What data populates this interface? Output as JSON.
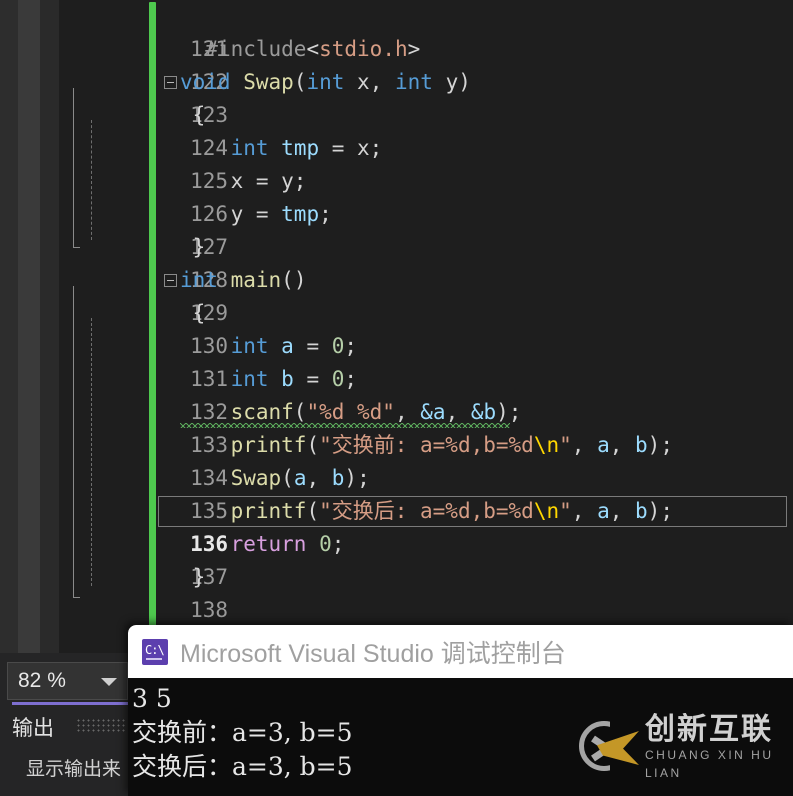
{
  "editor": {
    "zoom_level": "82 %",
    "current_line": 136,
    "first_line": 121,
    "lines": [
      {
        "number": "121",
        "text": ""
      },
      {
        "number": "122",
        "text": "#include<stdio.h>"
      },
      {
        "number": "123",
        "text": "void Swap(int x, int y)"
      },
      {
        "number": "124",
        "text": "{"
      },
      {
        "number": "125",
        "text": "int tmp = x;"
      },
      {
        "number": "126",
        "text": "x = y;"
      },
      {
        "number": "127",
        "text": "y = tmp;"
      },
      {
        "number": "128",
        "text": "}"
      },
      {
        "number": "129",
        "text": "int main()"
      },
      {
        "number": "130",
        "text": "{"
      },
      {
        "number": "131",
        "text": "int a = 0;"
      },
      {
        "number": "132",
        "text": "int b = 0;"
      },
      {
        "number": "133",
        "text": "scanf(\"%d %d\", &a, &b);"
      },
      {
        "number": "134",
        "text": "printf(\"交换前: a=%d,b=%d\\n\", a, b);"
      },
      {
        "number": "135",
        "text": "Swap(a, b);"
      },
      {
        "number": "136",
        "text": "printf(\"交换后: a=%d,b=%d\\n\", a, b);"
      },
      {
        "number": "137",
        "text": "return 0;"
      },
      {
        "number": "138",
        "text": "}"
      }
    ],
    "tokens": {
      "l122": [
        {
          "t": "  ",
          "c": "t-plain"
        },
        {
          "t": "#include",
          "c": "t-pre"
        },
        {
          "t": "<",
          "c": "t-plain"
        },
        {
          "t": "stdio.h",
          "c": "t-str-h"
        },
        {
          "t": ">",
          "c": "t-plain"
        }
      ],
      "l123": [
        {
          "t": "void",
          "c": "t-kw"
        },
        {
          "t": " ",
          "c": "t-plain"
        },
        {
          "t": "Swap",
          "c": "t-fn"
        },
        {
          "t": "(",
          "c": "t-plain"
        },
        {
          "t": "int",
          "c": "t-kw"
        },
        {
          "t": " x, ",
          "c": "t-plain"
        },
        {
          "t": "int",
          "c": "t-kw"
        },
        {
          "t": " y)",
          "c": "t-plain"
        }
      ],
      "l124": [
        {
          "t": " {",
          "c": "t-plain"
        }
      ],
      "l125": [
        {
          "t": "    ",
          "c": "t-plain"
        },
        {
          "t": "int",
          "c": "t-kw"
        },
        {
          "t": " ",
          "c": "t-plain"
        },
        {
          "t": "tmp",
          "c": "t-var"
        },
        {
          "t": " = x;",
          "c": "t-plain"
        }
      ],
      "l126": [
        {
          "t": "    x = y;",
          "c": "t-plain"
        }
      ],
      "l127": [
        {
          "t": "    y = ",
          "c": "t-plain"
        },
        {
          "t": "tmp",
          "c": "t-var"
        },
        {
          "t": ";",
          "c": "t-plain"
        }
      ],
      "l128": [
        {
          "t": " }",
          "c": "t-plain"
        }
      ],
      "l129": [
        {
          "t": "int",
          "c": "t-kw"
        },
        {
          "t": " ",
          "c": "t-plain"
        },
        {
          "t": "main",
          "c": "t-fn"
        },
        {
          "t": "()",
          "c": "t-plain"
        }
      ],
      "l130": [
        {
          "t": " {",
          "c": "t-plain"
        }
      ],
      "l131": [
        {
          "t": "    ",
          "c": "t-plain"
        },
        {
          "t": "int",
          "c": "t-kw"
        },
        {
          "t": " ",
          "c": "t-plain"
        },
        {
          "t": "a",
          "c": "t-var"
        },
        {
          "t": " = ",
          "c": "t-plain"
        },
        {
          "t": "0",
          "c": "t-num"
        },
        {
          "t": ";",
          "c": "t-plain"
        }
      ],
      "l132": [
        {
          "t": "    ",
          "c": "t-plain"
        },
        {
          "t": "int",
          "c": "t-kw"
        },
        {
          "t": " ",
          "c": "t-plain"
        },
        {
          "t": "b",
          "c": "t-var"
        },
        {
          "t": " = ",
          "c": "t-plain"
        },
        {
          "t": "0",
          "c": "t-num"
        },
        {
          "t": ";",
          "c": "t-plain"
        }
      ],
      "l133": [
        {
          "t": "    ",
          "c": "t-plain"
        },
        {
          "t": "scanf",
          "c": "t-fn"
        },
        {
          "t": "(",
          "c": "t-plain"
        },
        {
          "t": "\"%d %d\"",
          "c": "t-str-h"
        },
        {
          "t": ", ",
          "c": "t-plain"
        },
        {
          "t": "&a",
          "c": "t-var"
        },
        {
          "t": ", ",
          "c": "t-plain"
        },
        {
          "t": "&b",
          "c": "t-var"
        },
        {
          "t": ");",
          "c": "t-plain"
        }
      ],
      "l134": [
        {
          "t": "    ",
          "c": "t-plain"
        },
        {
          "t": "printf",
          "c": "t-fn"
        },
        {
          "t": "(",
          "c": "t-plain"
        },
        {
          "t": "\"交换前: a=%d,b=%d",
          "c": "t-str-h"
        },
        {
          "t": "\\n",
          "c": "t-esc"
        },
        {
          "t": "\"",
          "c": "t-str-h"
        },
        {
          "t": ", ",
          "c": "t-plain"
        },
        {
          "t": "a",
          "c": "t-var"
        },
        {
          "t": ", ",
          "c": "t-plain"
        },
        {
          "t": "b",
          "c": "t-var"
        },
        {
          "t": ");",
          "c": "t-plain"
        }
      ],
      "l135": [
        {
          "t": "    ",
          "c": "t-plain"
        },
        {
          "t": "Swap",
          "c": "t-fn"
        },
        {
          "t": "(",
          "c": "t-plain"
        },
        {
          "t": "a",
          "c": "t-var"
        },
        {
          "t": ", ",
          "c": "t-plain"
        },
        {
          "t": "b",
          "c": "t-var"
        },
        {
          "t": ");",
          "c": "t-plain"
        }
      ],
      "l136": [
        {
          "t": "    ",
          "c": "t-plain"
        },
        {
          "t": "printf",
          "c": "t-fn"
        },
        {
          "t": "(",
          "c": "t-plain"
        },
        {
          "t": "\"交换后: a=%d,b=%d",
          "c": "t-str-h"
        },
        {
          "t": "\\n",
          "c": "t-esc"
        },
        {
          "t": "\"",
          "c": "t-str-h"
        },
        {
          "t": ", ",
          "c": "t-plain"
        },
        {
          "t": "a",
          "c": "t-var"
        },
        {
          "t": ", ",
          "c": "t-plain"
        },
        {
          "t": "b",
          "c": "t-var"
        },
        {
          "t": ");",
          "c": "t-plain"
        }
      ],
      "l137": [
        {
          "t": "    ",
          "c": "t-plain"
        },
        {
          "t": "return",
          "c": "t-ctl"
        },
        {
          "t": " ",
          "c": "t-plain"
        },
        {
          "t": "0",
          "c": "t-num"
        },
        {
          "t": ";",
          "c": "t-plain"
        }
      ],
      "l138": [
        {
          "t": " }",
          "c": "t-plain"
        }
      ]
    }
  },
  "output_pane": {
    "tab_label": "输出",
    "source_label": "显示输出来"
  },
  "console": {
    "title": "Microsoft Visual Studio 调试控制台",
    "icon": "console-app-icon",
    "lines": [
      "3 5",
      "交换前：a=3, b=5",
      "交换后：a=3, b=5"
    ]
  },
  "watermark": {
    "chinese": "创新互联",
    "pinyin": "CHUANG XIN HU LIAN"
  },
  "colors": {
    "editor_bg": "#1e1e1e",
    "change_bar_green": "#4ec94e",
    "output_accent_purple": "#7e6fd0",
    "console_bg": "#0c0c0c",
    "console_title_bg": "#ffffff",
    "watermark_gold": "#d8a72a"
  }
}
